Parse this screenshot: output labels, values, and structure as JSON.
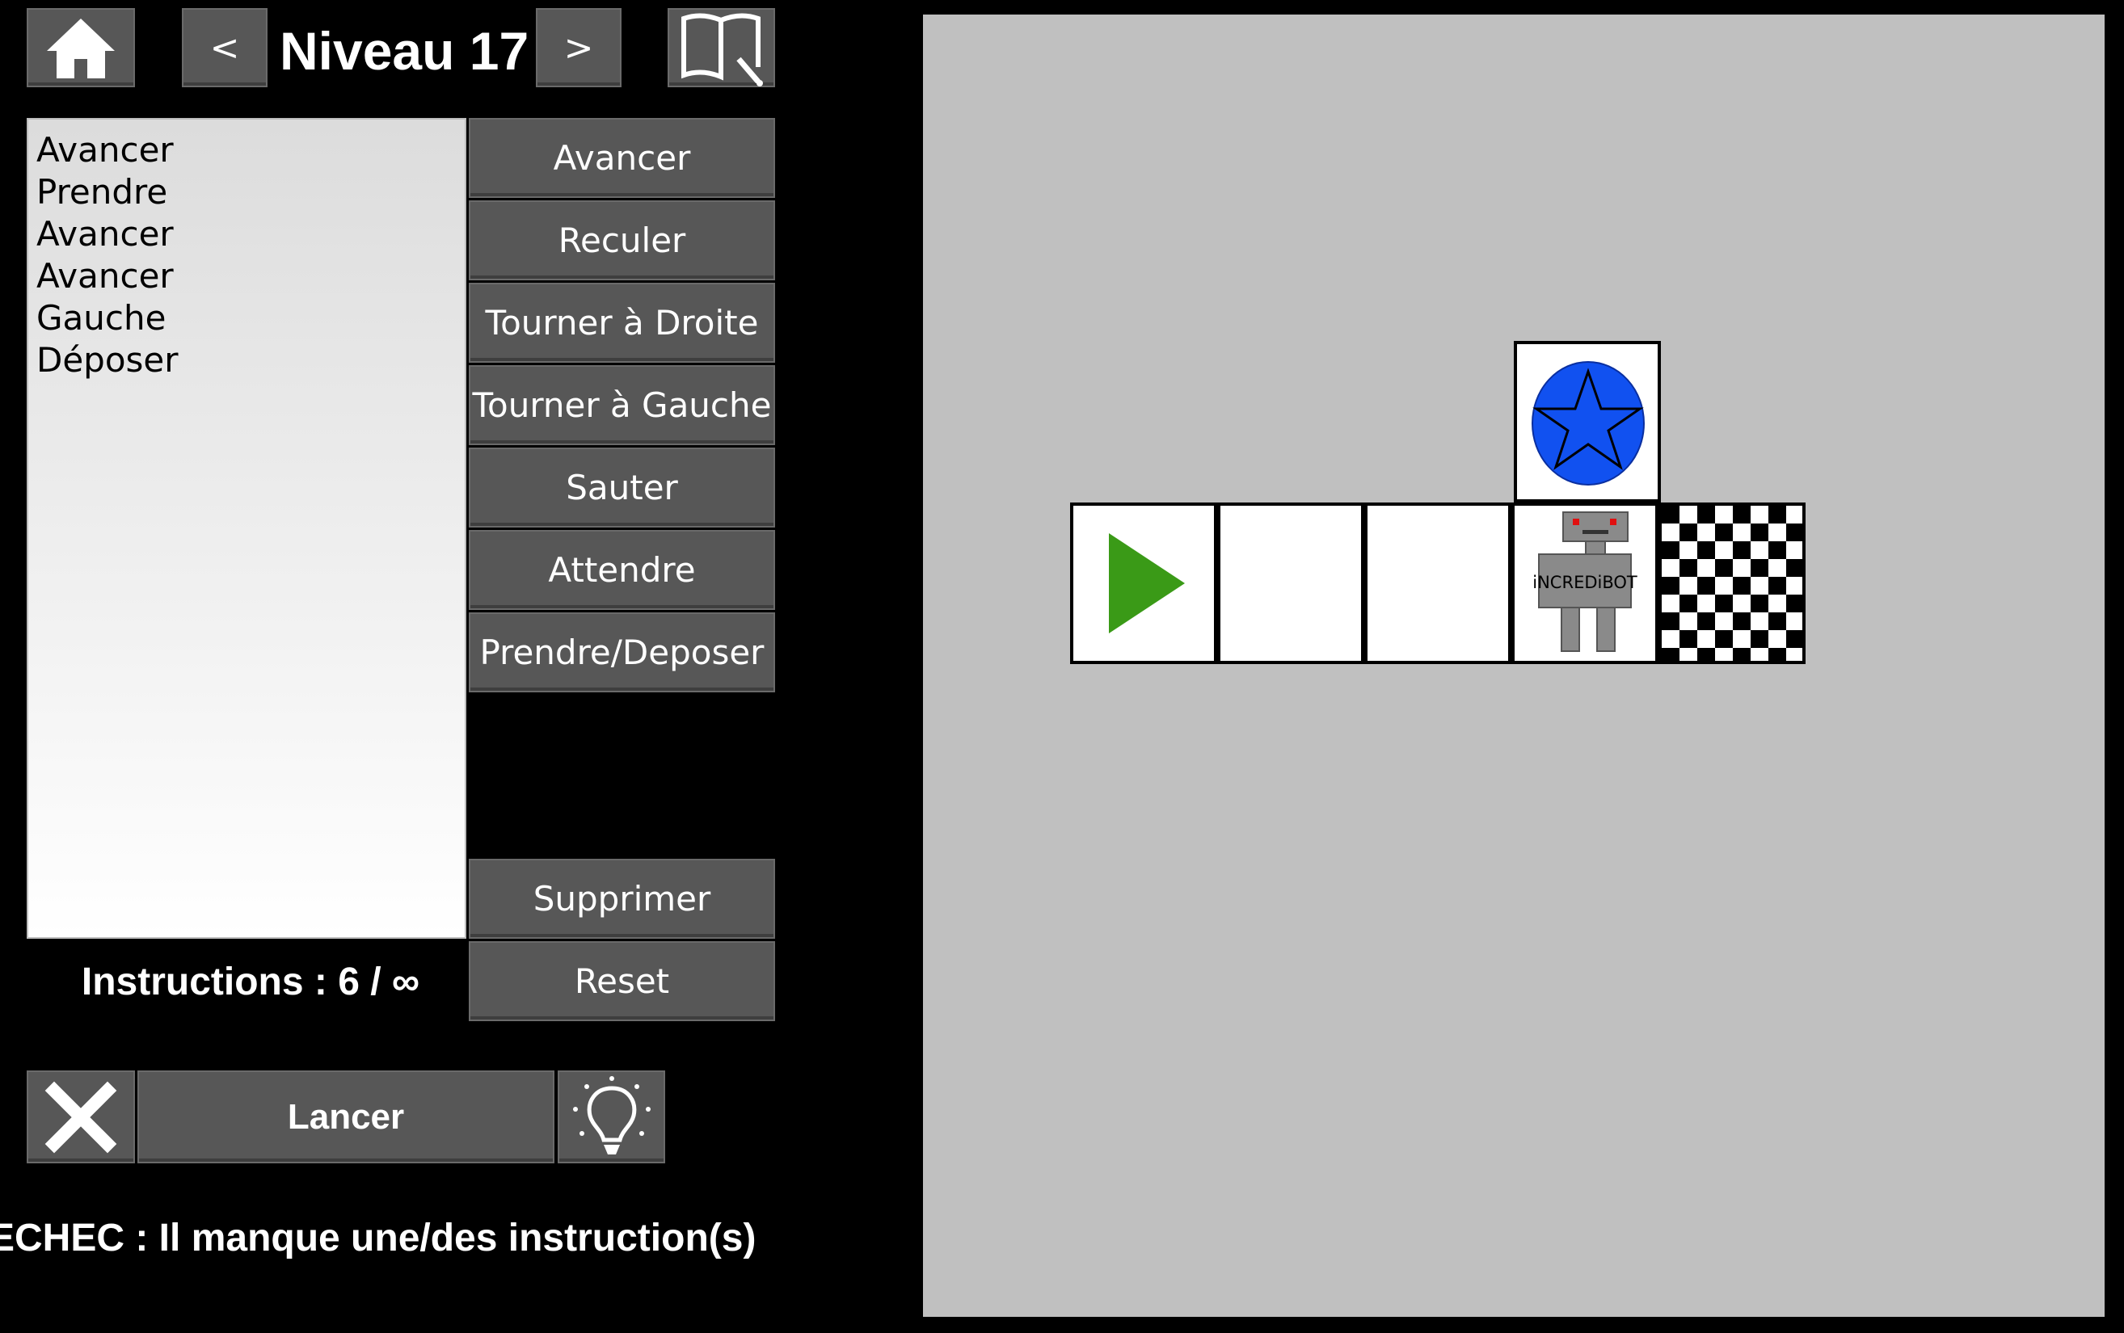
{
  "header": {
    "level_title": "Niveau 17",
    "prev_label": "<",
    "next_label": ">",
    "home_icon": "home-icon",
    "manual_icon": "book-icon"
  },
  "program": {
    "lines": [
      "Avancer",
      "Prendre",
      "Avancer",
      "Avancer",
      "Gauche",
      "Déposer"
    ]
  },
  "commands": {
    "forward": "Avancer",
    "backward": "Reculer",
    "turn_right": "Tourner à Droite",
    "turn_left": "Tourner à Gauche",
    "jump": "Sauter",
    "wait": "Attendre",
    "pick_drop": "Prendre/Deposer",
    "delete": "Supprimer",
    "reset": "Reset"
  },
  "instructions_counter": "Instructions : 6 / ∞",
  "controls": {
    "run_label": "Lancer",
    "clear_icon": "close-icon",
    "hint_icon": "lightbulb-icon"
  },
  "status_message": "ECHEC : Il manque une/des instruction(s)",
  "board": {
    "robot_label": "iNCREDiBOT",
    "tiles": [
      "start",
      "empty",
      "empty",
      "robot",
      "finish",
      "star-goal"
    ]
  },
  "colors": {
    "button": "#575757",
    "board": "#c0c0c0",
    "start_arrow": "#3a9a17",
    "star_disc": "#1151f0"
  }
}
